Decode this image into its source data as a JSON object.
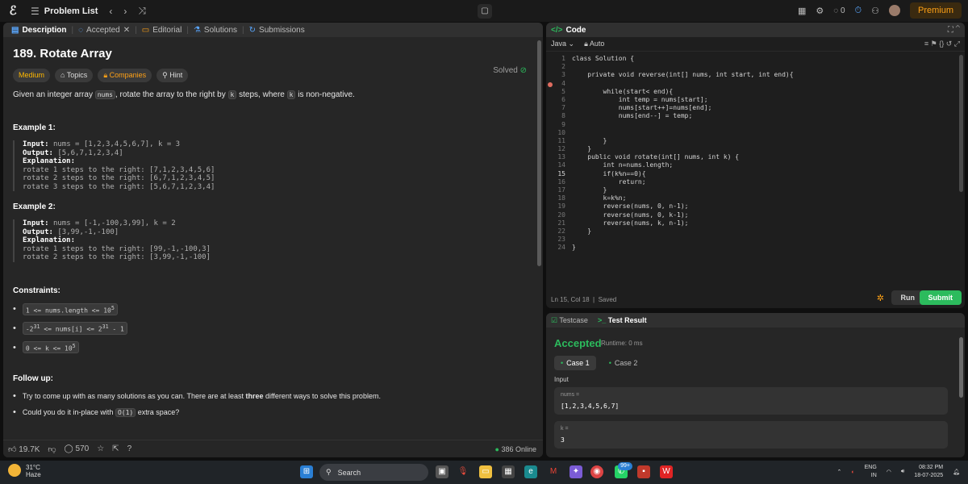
{
  "topbar": {
    "title": "Problem List",
    "coins": "0",
    "premium": "Premium"
  },
  "left_tabs": [
    {
      "label": "Description"
    },
    {
      "label": "Accepted"
    },
    {
      "label": "Editorial"
    },
    {
      "label": "Solutions"
    },
    {
      "label": "Submissions"
    }
  ],
  "problem": {
    "title": "189. Rotate Array",
    "status": "Solved",
    "difficulty": "Medium",
    "topics": "Topics",
    "companies": "Companies",
    "hint": "Hint",
    "statement_a": "Given an integer array",
    "statement_code1": "nums",
    "statement_b": ", rotate the array to the right by",
    "statement_code2": "k",
    "statement_c": "steps, where",
    "statement_code3": "k",
    "statement_d": "is non-negative.",
    "ex1_title": "Example 1:",
    "ex1_input_label": "Input:",
    "ex1_input": "nums = [1,2,3,4,5,6,7], k = 3",
    "ex1_output_label": "Output:",
    "ex1_output": "[5,6,7,1,2,3,4]",
    "ex1_expl_label": "Explanation:",
    "ex1_l1": "rotate 1 steps to the right: [7,1,2,3,4,5,6]",
    "ex1_l2": "rotate 2 steps to the right: [6,7,1,2,3,4,5]",
    "ex1_l3": "rotate 3 steps to the right: [5,6,7,1,2,3,4]",
    "ex2_title": "Example 2:",
    "ex2_input_label": "Input:",
    "ex2_input": "nums = [-1,-100,3,99], k = 2",
    "ex2_output_label": "Output:",
    "ex2_output": "[3,99,-1,-100]",
    "ex2_expl_label": "Explanation:",
    "ex2_l1": "rotate 1 steps to the right: [99,-1,-100,3]",
    "ex2_l2": "rotate 2 steps to the right: [3,99,-1,-100]",
    "constraints_title": "Constraints:",
    "c1a": "1 <= nums.length <= 10",
    "c1sup": "5",
    "c2a": "-2",
    "c2sup1": "31",
    "c2b": " <= nums[i] <= 2",
    "c2sup2": "31",
    "c2c": " - 1",
    "c3a": "0 <= k <= 10",
    "c3sup": "5",
    "followup_title": "Follow up:",
    "f1a": "Try to come up with as many solutions as you can. There are at least",
    "f1b": "three",
    "f1c": "different ways to solve this problem.",
    "f2a": "Could you do it in-place with",
    "f2code": "O(1)",
    "f2b": "extra space?"
  },
  "left_bottom": {
    "likes": "19.7K",
    "comments": "570",
    "online": "386 Online"
  },
  "code_panel": {
    "title": "Code",
    "language": "Java",
    "auto": "Auto",
    "lines": [
      "class Solution {",
      "",
      "    private void reverse(int[] nums, int start, int end){",
      "",
      "        while(start< end){",
      "            int temp = nums[start];",
      "            nums[start++]=nums[end];",
      "            nums[end--] = temp;",
      "",
      "",
      "        }",
      "    }",
      "    public void rotate(int[] nums, int k) {",
      "        int n=nums.length;",
      "        if(k%n==0){",
      "            return;",
      "        }",
      "        k=k%n;",
      "        reverse(nums, 0, n-1);",
      "        reverse(nums, 0, k-1);",
      "        reverse(nums, k, n-1);",
      "    }",
      "",
      "}"
    ],
    "cursor_line": 15,
    "status_pos": "Ln 15, Col 18",
    "status_saved": "Saved",
    "run": "Run",
    "submit": "Submit"
  },
  "test_panel": {
    "tab1": "Testcase",
    "tab2": "Test Result",
    "result": "Accepted",
    "runtime": "Runtime: 0 ms",
    "case1": "Case 1",
    "case2": "Case 2",
    "input_label": "Input",
    "var1_name": "nums =",
    "var1_value": "[1,2,3,4,5,6,7]",
    "var2_name": "k =",
    "var2_value": "3"
  },
  "taskbar": {
    "temp": "31°C",
    "weather": "Haze",
    "search": "Search",
    "badge": "99+",
    "lang1": "ENG",
    "lang2": "IN",
    "time": "08:32 PM",
    "date": "18-07-2025"
  },
  "colors": {
    "accent_green": "#2cbb5d",
    "premium_orange": "#ffa116",
    "medium_yellow": "#ffb800"
  }
}
